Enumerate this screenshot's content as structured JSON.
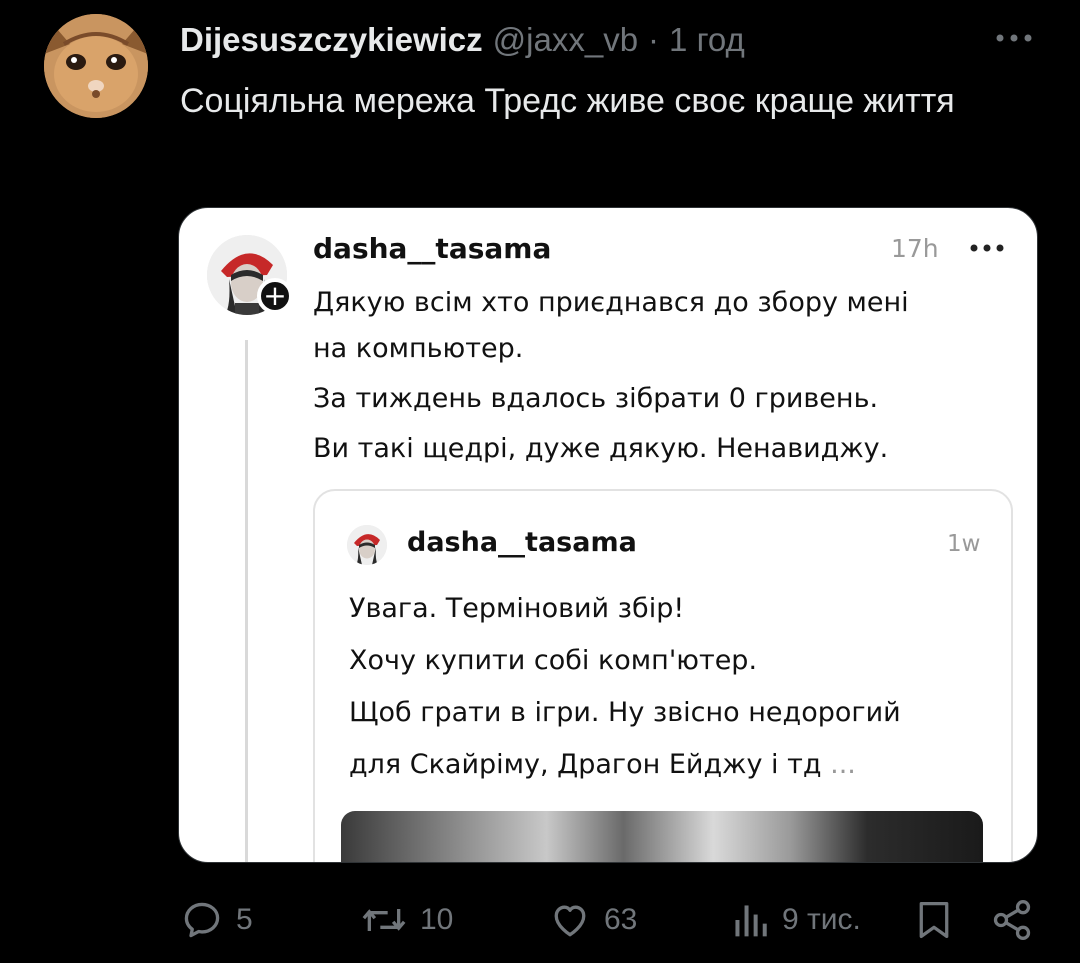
{
  "tweet": {
    "display_name": "Dijesuszczykiewicz",
    "handle": "@jaxx_vb",
    "separator": "·",
    "time": "1 год",
    "text": "Соціяльна мережа Тредс живе своє краще життя"
  },
  "screenshot": {
    "post": {
      "username": "dasha__tasama",
      "time": "17h",
      "text_lines": [
        "Дякую всім хто приєднався до збору мені",
        "на компьютер.",
        "За тиждень вдалось зібрати 0 гривень.",
        "Ви такі щедрі, дуже дякую. Ненавиджу."
      ]
    },
    "quoted": {
      "username": "dasha__tasama",
      "time": "1w",
      "text_lines": [
        "Увага. Терміновий збір!",
        "Хочу купити собі комп'ютер.",
        "Щоб грати в ігри. Ну звісно недорогий"
      ],
      "last_line": "для Скайріму, Драгон Ейджу і тд",
      "truncation": "..."
    }
  },
  "actions": {
    "replies": "5",
    "reposts": "10",
    "likes": "63",
    "views": "9 тис."
  },
  "colors": {
    "background": "#000000",
    "text_primary": "#e7e9ea",
    "text_muted": "#71767b",
    "card_background": "#ffffff"
  },
  "icons": [
    "more-icon",
    "reply-icon",
    "repost-icon",
    "like-icon",
    "views-icon",
    "bookmark-icon",
    "share-icon",
    "plus-icon"
  ]
}
